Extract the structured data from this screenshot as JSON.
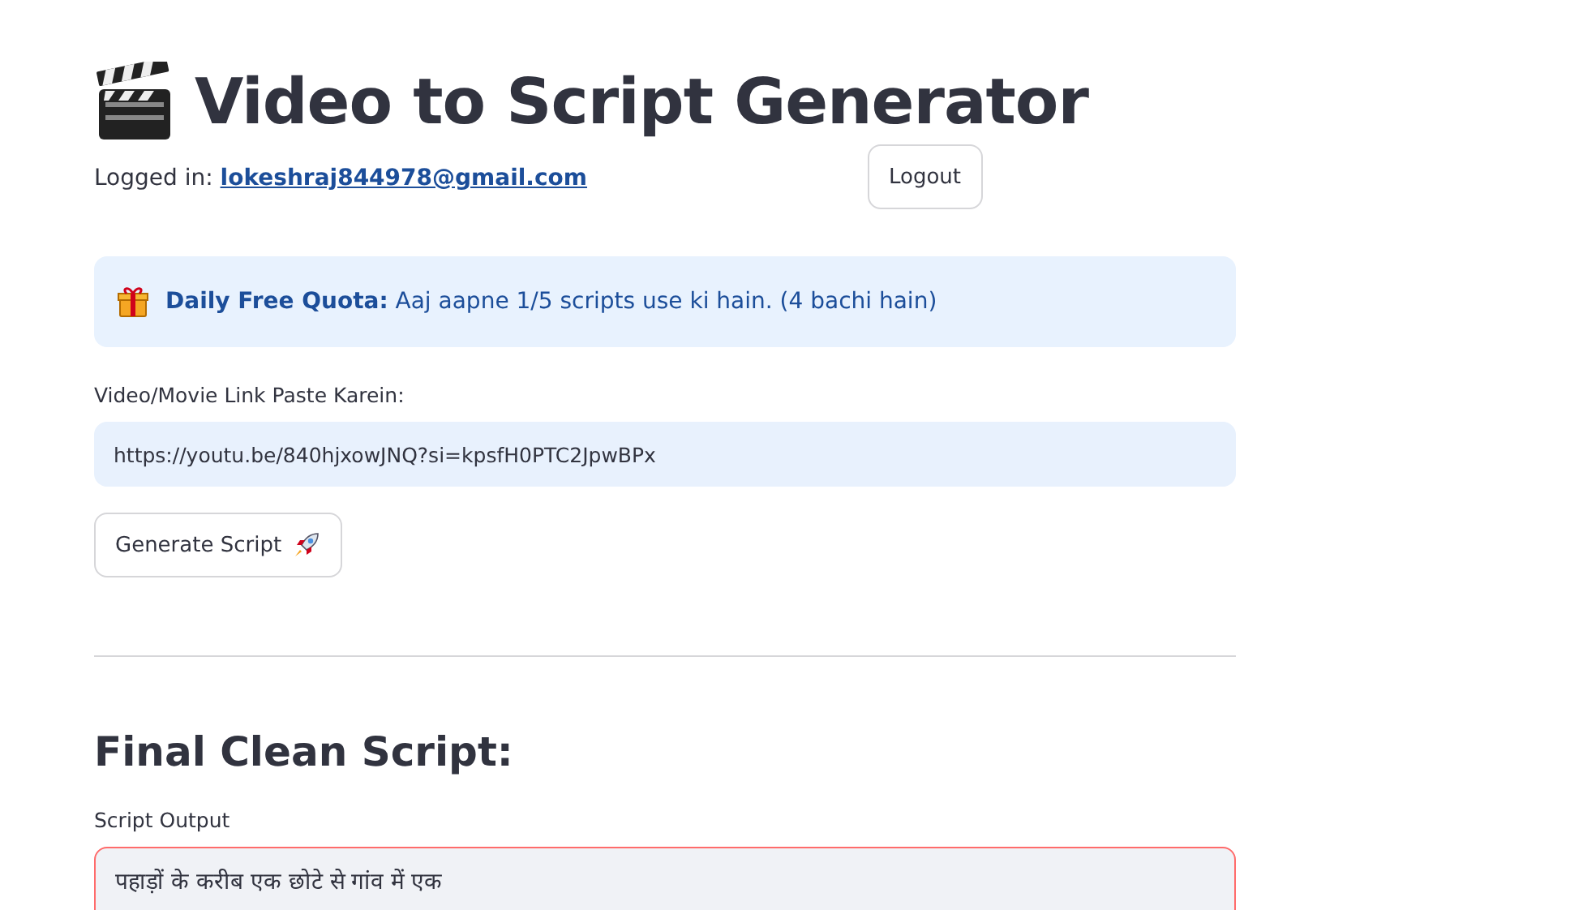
{
  "title": "Video to Script Generator",
  "login": {
    "label": "Logged in:",
    "email": "lokeshraj844978@gmail.com"
  },
  "logout_button": "Logout",
  "quota_notice": "**Daily Free Quota:** Aaj aapne 1/5 scripts use ki hain. (4 bachi hain)",
  "link_field": {
    "label": "Video/Movie Link Paste Karein:",
    "value": "https://youtu.be/840hjxowJNQ?si=kpsfH0PTC2JpwBPx"
  },
  "generate_button": "Generate Script",
  "output": {
    "heading": "Final Clean Script:",
    "label": "Script Output",
    "value": "पहाड़ों के करीब एक छोटे से गांव में एक"
  }
}
